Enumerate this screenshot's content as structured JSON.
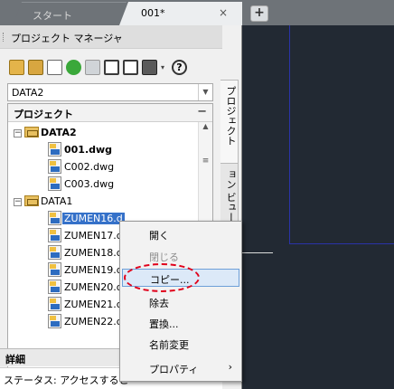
{
  "tabs": {
    "start_label": "スタート",
    "doc_label": "001*",
    "close_glyph": "×",
    "add_glyph": "+"
  },
  "panel": {
    "title": "プロジェクト マネージャ",
    "combo_value": "DATA2",
    "tree_header": "プロジェクト",
    "tree_header_toggle": "−",
    "vertical_tab_project": "プロジェクト",
    "vertical_tab_view": "ョン ビュー",
    "details_label": "詳細",
    "status_text": "ステータス: アクセスすることができ"
  },
  "toolbar_icons": [
    "open-folder-icon",
    "new-project-icon",
    "image-icon",
    "refresh-icon",
    "edit-icon",
    "frame-icon",
    "view-icon",
    "print-icon",
    "dropdown-arrow-icon",
    "help-icon"
  ],
  "tree": [
    {
      "label": "DATA2",
      "type": "folder",
      "bold": true
    },
    {
      "label": "001.dwg",
      "type": "dwg",
      "bold": true
    },
    {
      "label": "C002.dwg",
      "type": "dwg"
    },
    {
      "label": "C003.dwg",
      "type": "dwg"
    },
    {
      "label": "DATA1",
      "type": "folder"
    },
    {
      "label": "ZUMEN16.d",
      "type": "dwg",
      "selected": true
    },
    {
      "label": "ZUMEN17.d",
      "type": "dwg"
    },
    {
      "label": "ZUMEN18.d",
      "type": "dwg"
    },
    {
      "label": "ZUMEN19.d",
      "type": "dwg"
    },
    {
      "label": "ZUMEN20.d",
      "type": "dwg"
    },
    {
      "label": "ZUMEN21.d",
      "type": "dwg"
    },
    {
      "label": "ZUMEN22.d",
      "type": "dwg"
    }
  ],
  "context_menu": [
    {
      "label": "開く",
      "state": "normal"
    },
    {
      "label": "閉じる",
      "state": "disabled"
    },
    {
      "label": "コピー...",
      "state": "hover"
    },
    {
      "label": "除去",
      "state": "normal"
    },
    {
      "label": "置換...",
      "state": "normal"
    },
    {
      "label": "名前変更",
      "state": "normal"
    },
    {
      "label": "プロパティ",
      "state": "normal",
      "submenu": "›"
    }
  ],
  "colors": {
    "selection": "#3571c9",
    "highlight_ellipse": "#e0001a",
    "canvas": "#222933",
    "frame_line": "#2a33a8"
  }
}
